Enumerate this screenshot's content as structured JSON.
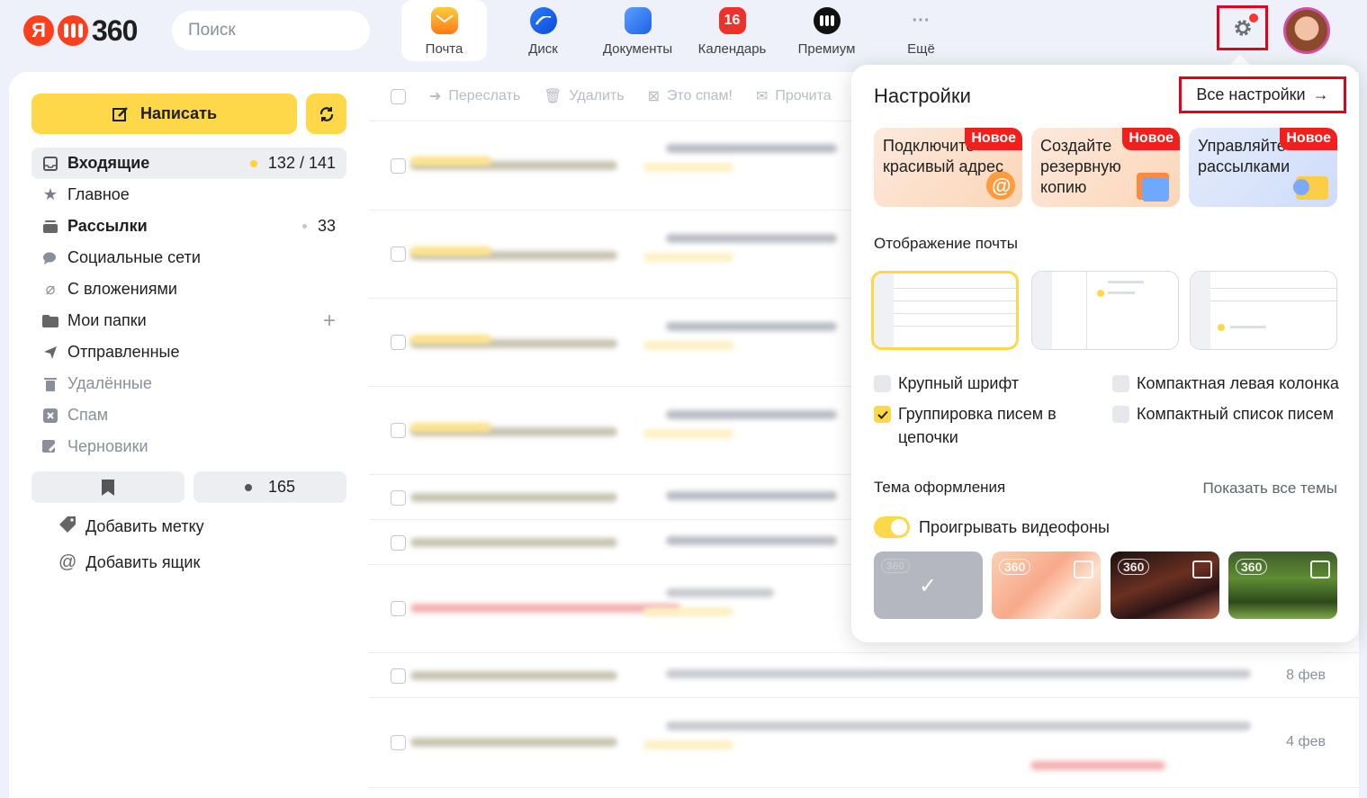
{
  "header": {
    "logo_text": "360",
    "search_placeholder": "Поиск",
    "apps": [
      {
        "label": "Почта",
        "icon": "mail-icon",
        "active": true
      },
      {
        "label": "Диск",
        "icon": "disk-icon"
      },
      {
        "label": "Документы",
        "icon": "documents-icon"
      },
      {
        "label": "Календарь",
        "icon": "calendar-icon",
        "badge": "16"
      },
      {
        "label": "Премиум",
        "icon": "premium-icon"
      },
      {
        "label": "Ещё",
        "icon": "more-icon"
      }
    ]
  },
  "sidebar": {
    "compose_label": "Написать",
    "folders": [
      {
        "name": "Входящие",
        "count": "132 / 141",
        "icon": "inbox-icon"
      },
      {
        "name": "Главное",
        "icon": "star-icon"
      },
      {
        "name": "Рассылки",
        "count": "33",
        "icon": "newsletters-icon"
      },
      {
        "name": "Социальные сети",
        "icon": "social-icon"
      },
      {
        "name": "С вложениями",
        "icon": "paperclip-icon"
      },
      {
        "name": "Мои папки",
        "icon": "folder-icon"
      },
      {
        "name": "Отправленные",
        "icon": "sent-icon"
      },
      {
        "name": "Удалённые",
        "icon": "trash-icon"
      },
      {
        "name": "Спам",
        "icon": "spam-icon"
      },
      {
        "name": "Черновики",
        "icon": "drafts-icon"
      }
    ],
    "unread_count": "165",
    "add_label": "Добавить метку",
    "add_mailbox": "Добавить ящик"
  },
  "toolbar": {
    "forward": "Переслать",
    "delete": "Удалить",
    "spam": "Это спам!",
    "read": "Прочита"
  },
  "mail_list": {
    "rows": [
      {
        "date": ""
      },
      {
        "date": ""
      },
      {
        "date": ""
      },
      {
        "date": ""
      },
      {
        "date": ""
      },
      {
        "date": ""
      },
      {
        "date": ""
      },
      {
        "date": "8 фев"
      },
      {
        "date": "4 фев"
      }
    ]
  },
  "settings_popup": {
    "title": "Настройки",
    "all_settings": "Все настройки",
    "promos": [
      {
        "text": "Подключите красивый адрес",
        "badge": "Новое"
      },
      {
        "text": "Создайте резервную копию",
        "badge": "Новое"
      },
      {
        "text": "Управляйте рассылками",
        "badge": "Новое"
      }
    ],
    "display_title": "Отображение почты",
    "options": {
      "large_font": "Крупный шрифт",
      "compact_left": "Компактная левая колонка",
      "grouping": "Группировка писем в цепочки",
      "compact_list": "Компактный список писем"
    },
    "theme_title": "Тема оформления",
    "show_all_themes": "Показать все темы",
    "video_bg": "Проигрывать видеофоны",
    "theme_badge": "360"
  },
  "colors": {
    "accent": "#fed848",
    "highlight_box": "#e3001b",
    "new_badge": "#f0211d"
  }
}
